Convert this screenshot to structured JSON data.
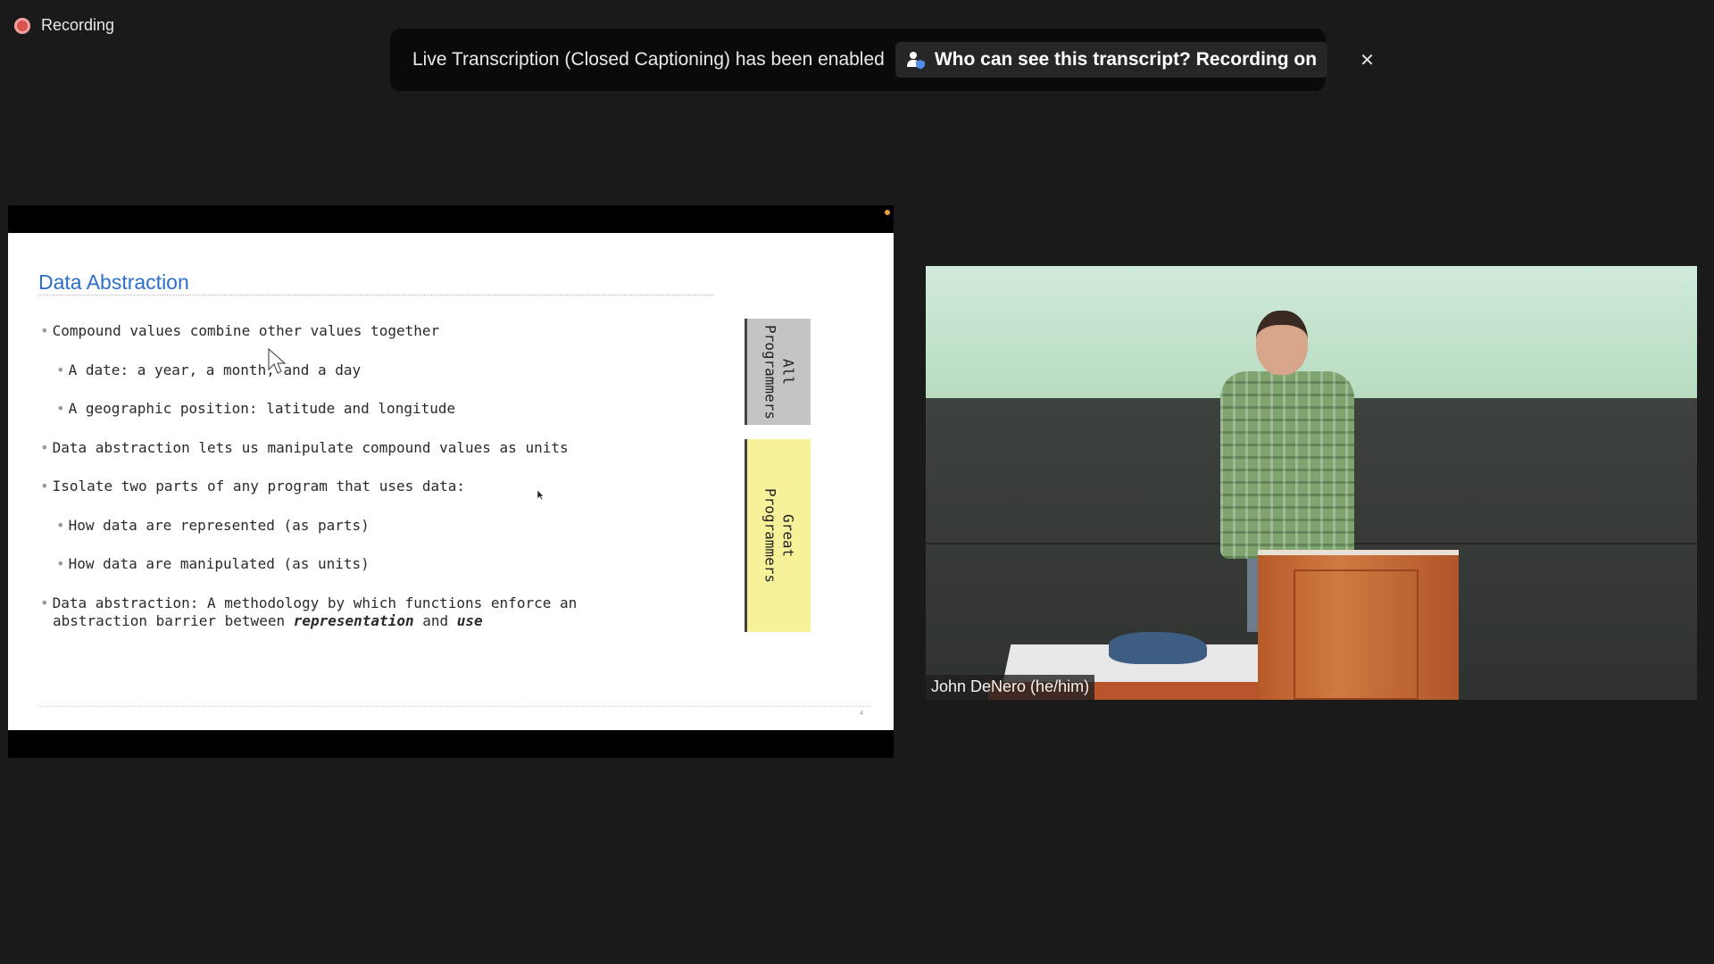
{
  "recording": {
    "label": "Recording"
  },
  "banner": {
    "message": "Live Transcription (Closed Captioning) has been enabled",
    "who_label": "Who can see this transcript? Recording on",
    "close_glyph": "✕"
  },
  "slide": {
    "title": "Data Abstraction",
    "bullets": [
      {
        "text": "Compound values combine other values together",
        "level": 1
      },
      {
        "text": "A date: a year, a month, and a day",
        "level": 2
      },
      {
        "text": "A geographic position: latitude and longitude",
        "level": 2
      },
      {
        "text": "Data abstraction lets us manipulate compound values as units",
        "level": 1
      },
      {
        "text": "Isolate two parts of any program that uses data:",
        "level": 1
      },
      {
        "text": "How data are represented (as parts)",
        "level": 2
      },
      {
        "text": "How data are manipulated (as units)",
        "level": 2
      }
    ],
    "last_bullet": {
      "line1": "Data abstraction: A methodology by which functions enforce an",
      "line2_prefix": "abstraction barrier between ",
      "line2_em1": "representation",
      "line2_mid": " and ",
      "line2_em2": "use"
    },
    "tab_all": "All\nProgrammers",
    "tab_great": "Great\nProgrammers",
    "page_number": "4",
    "colors": {
      "title": "#2b6fc8",
      "tab_all": "#c4c4c4",
      "tab_great": "#f7f29a"
    }
  },
  "video": {
    "participant_name": "John DeNero (he/him)"
  },
  "icons": {
    "recording": "recording-dot-icon",
    "who": "person-shield-icon",
    "close": "close-icon"
  }
}
